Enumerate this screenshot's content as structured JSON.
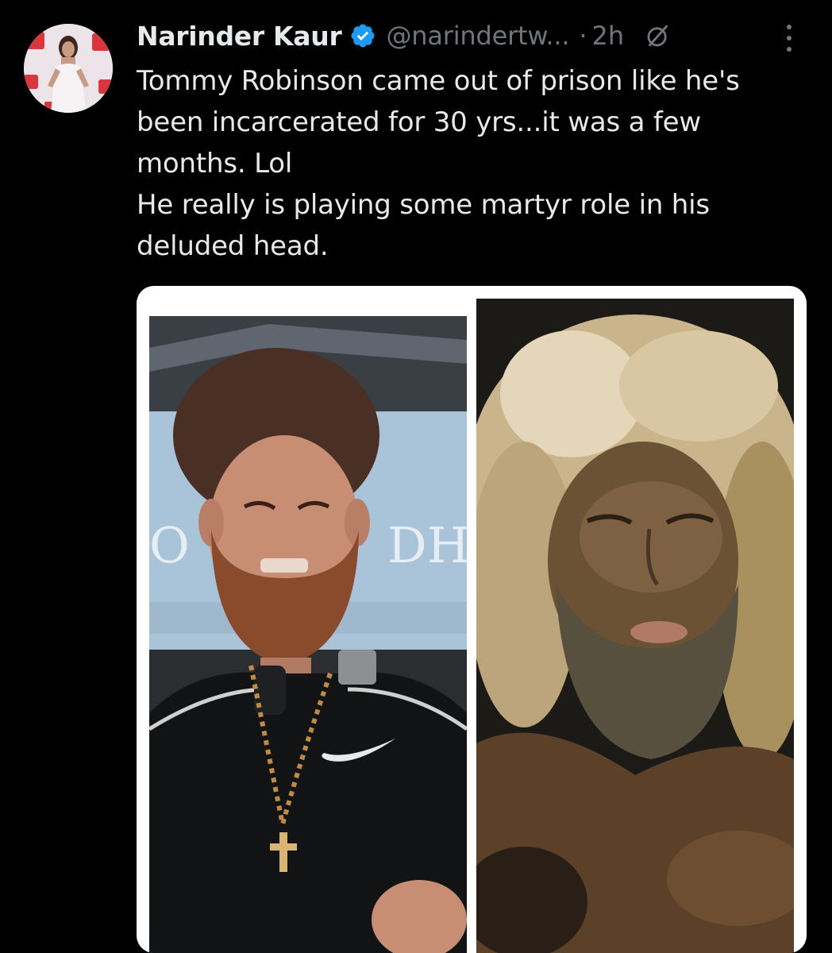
{
  "tweet": {
    "display_name": "Narinder Kaur",
    "handle": "@narindertw...",
    "separator": "·",
    "time": "2h",
    "text": "Tommy Robinson came out of prison like he's\nbeen incarcerated for 30 yrs...it was a few\nmonths. Lol\nHe really is playing some martyr role in his\ndeluded head.",
    "verified_icon": "verified-badge-icon",
    "grok_icon": "grok-icon",
    "more_icon": "more-vertical-icon"
  },
  "media": {
    "left_photo": {
      "sign_text_left": "O",
      "sign_text_right": "DH"
    },
    "right_photo": {}
  },
  "colors": {
    "background": "#000000",
    "text_primary": "#e7e9ea",
    "text_secondary": "#71767b",
    "verified_blue": "#1d9bf0",
    "card_border": "#ffffff"
  }
}
